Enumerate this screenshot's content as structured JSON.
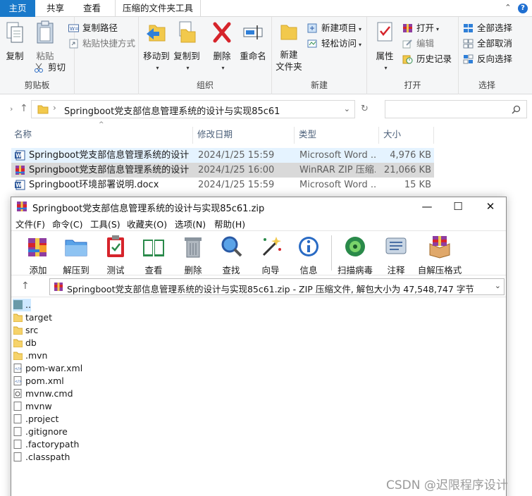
{
  "ribbon_tabs": [
    "主页",
    "共享",
    "查看",
    "压缩的文件夹工具"
  ],
  "clipboard": {
    "copy": "复制",
    "paste": "粘贴",
    "copy_path": "复制路径",
    "paste_shortcut": "粘贴快捷方式",
    "cut": "剪切",
    "group": "剪贴板"
  },
  "organize": {
    "move_to": "移动到",
    "copy_to": "复制到",
    "delete": "删除",
    "rename": "重命名",
    "group": "组织"
  },
  "new": {
    "new_folder_l1": "新建",
    "new_folder_l2": "文件夹",
    "new_item": "新建项目",
    "easy_access": "轻松访问",
    "group": "新建"
  },
  "open": {
    "properties": "属性",
    "open": "打开",
    "edit": "编辑",
    "history": "历史记录",
    "group": "打开"
  },
  "select": {
    "select_all": "全部选择",
    "select_none": "全部取消",
    "invert": "反向选择",
    "group": "选择"
  },
  "address": {
    "path": "Springboot党支部信息管理系统的设计与实现85c61"
  },
  "columns": {
    "name": "名称",
    "date": "修改日期",
    "type": "类型",
    "size": "大小"
  },
  "files": [
    {
      "name": "Springboot党支部信息管理系统的设计...",
      "date": "2024/1/25 15:59",
      "type": "Microsoft Word ...",
      "size": "4,976 KB"
    },
    {
      "name": "Springboot党支部信息管理系统的设计...",
      "date": "2024/1/25 16:00",
      "type": "WinRAR ZIP 压缩...",
      "size": "21,066 KB"
    },
    {
      "name": "Springboot环境部署说明.docx",
      "date": "2024/1/25 15:59",
      "type": "Microsoft Word ...",
      "size": "15 KB"
    }
  ],
  "winrar": {
    "title": "Springboot党支部信息管理系统的设计与实现85c61.zip",
    "menu": [
      "文件(F)",
      "命令(C)",
      "工具(S)",
      "收藏夹(O)",
      "选项(N)",
      "帮助(H)"
    ],
    "toolbar": [
      "添加",
      "解压到",
      "测试",
      "查看",
      "删除",
      "查找",
      "向导",
      "信息",
      "扫描病毒",
      "注释",
      "自解压格式"
    ],
    "path_info": "Springboot党支部信息管理系统的设计与实现85c61.zip - ZIP 压缩文件, 解包大小为 47,548,747 字节",
    "items": [
      "..",
      "target",
      "src",
      "db",
      ".mvn",
      "pom-war.xml",
      "pom.xml",
      "mvnw.cmd",
      "mvnw",
      ".project",
      ".gitignore",
      ".factorypath",
      ".classpath"
    ]
  },
  "watermark": "CSDN @迟限程序设计"
}
